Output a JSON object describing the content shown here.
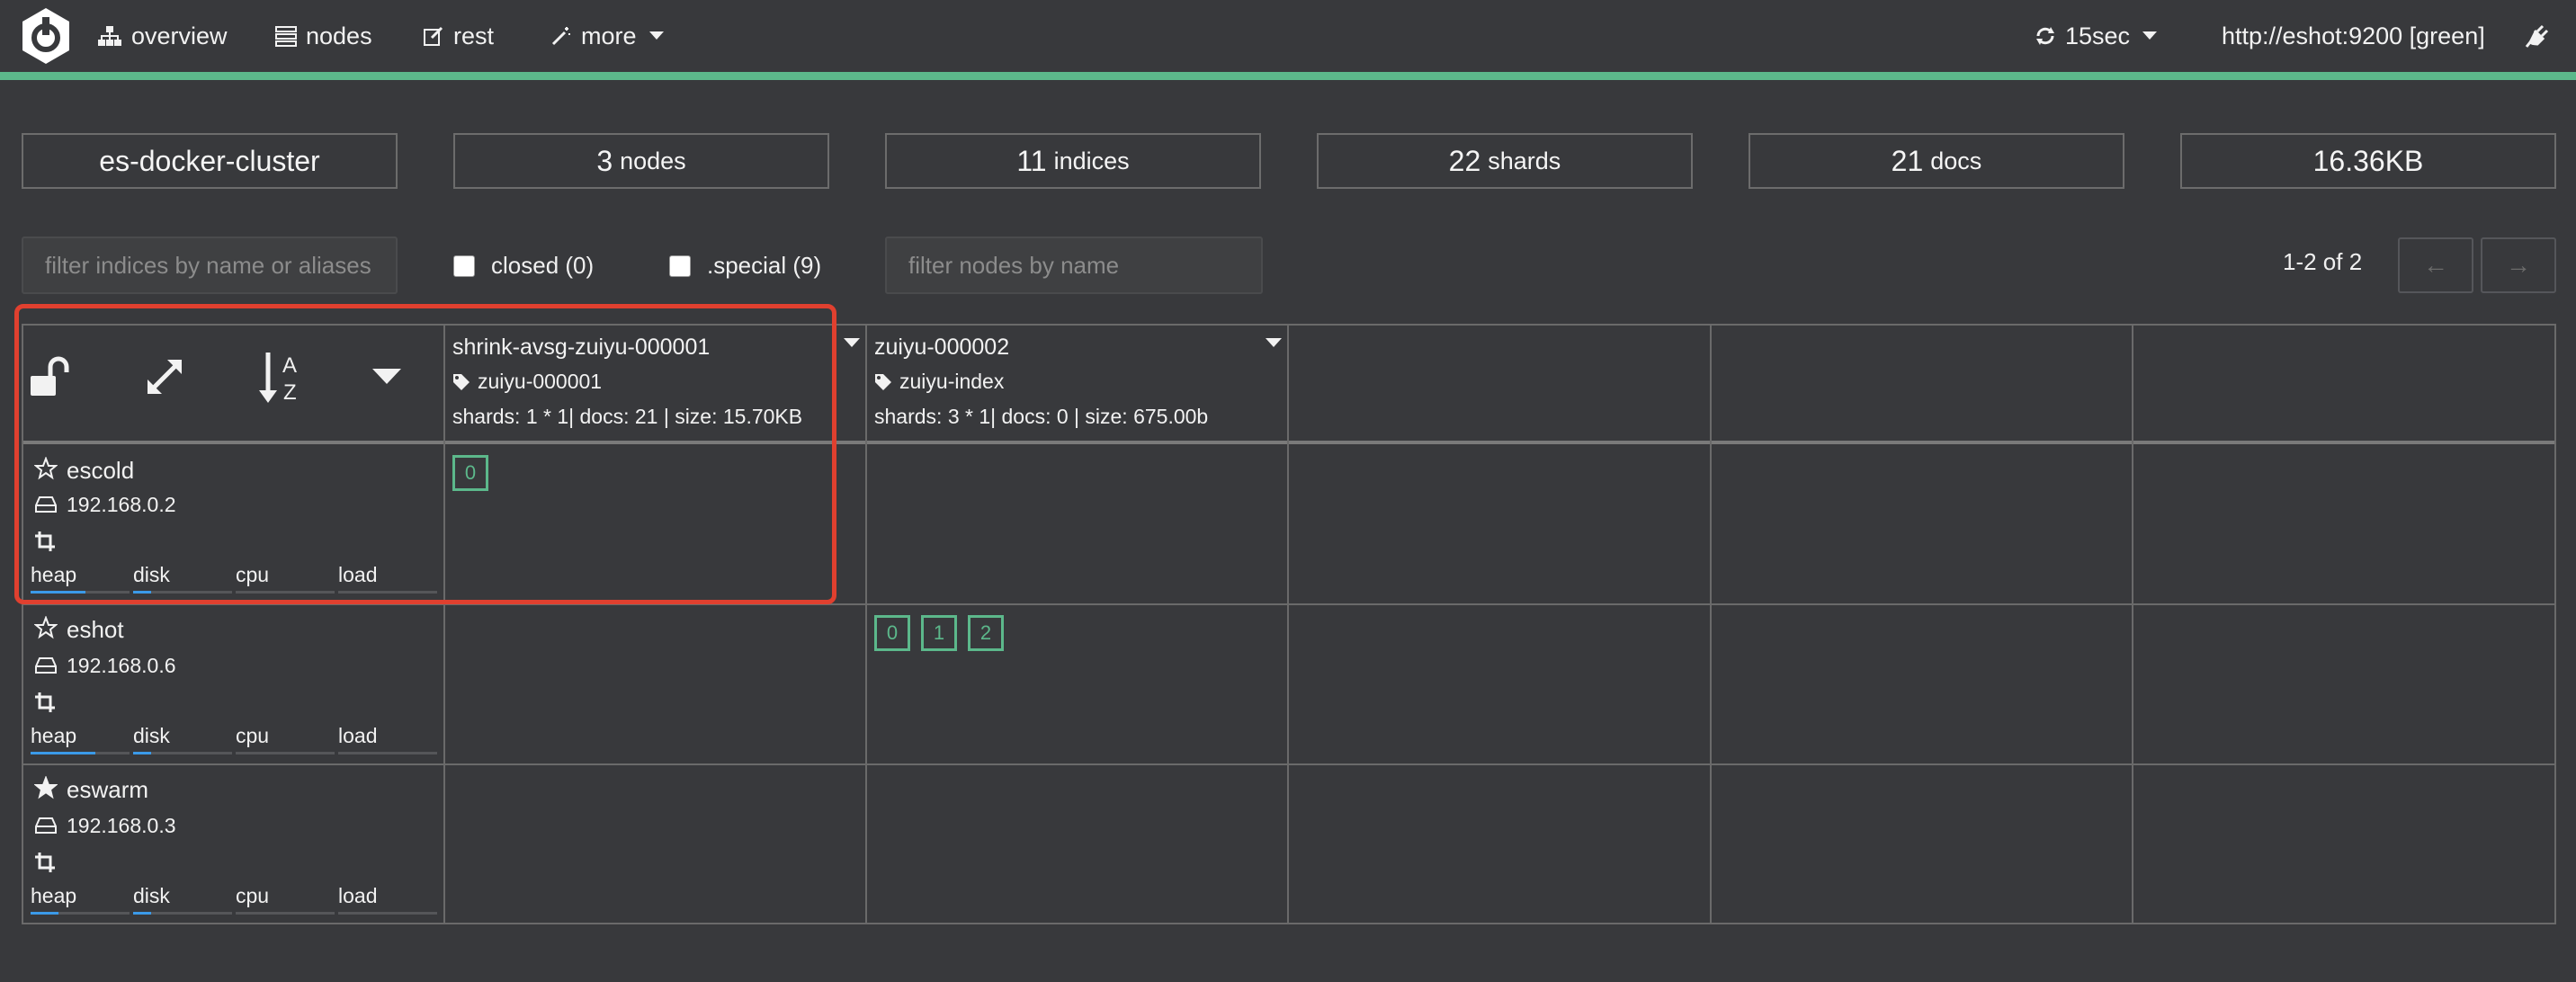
{
  "nav": {
    "overview": "overview",
    "nodes": "nodes",
    "rest": "rest",
    "more": "more",
    "refresh": "15sec",
    "connection": "http://eshot:9200 [green]"
  },
  "colors": {
    "status": "#5cb88b",
    "bar": "#3b9ae8",
    "highlight": "#e0402f"
  },
  "stats": {
    "cluster": "es-docker-cluster",
    "nodes_count": "3",
    "nodes_label": "nodes",
    "indices_count": "11",
    "indices_label": "indices",
    "shards_count": "22",
    "shards_label": "shards",
    "docs_count": "21",
    "docs_label": "docs",
    "size": "16.36KB"
  },
  "filters": {
    "indices_placeholder": "filter indices by name or aliases",
    "closed_label": "closed (0)",
    "special_label": ".special (9)",
    "nodes_placeholder": "filter nodes by name",
    "page_info": "1-2 of 2",
    "prev": "←",
    "next": "→"
  },
  "indices": [
    {
      "name": "shrink-avsg-zuiyu-000001",
      "alias": "zuiyu-000001",
      "info": "shards: 1 * 1| docs: 21 | size: 15.70KB"
    },
    {
      "name": "zuiyu-000002",
      "alias": "zuiyu-index",
      "info": "shards: 3 * 1| docs: 0 | size: 675.00b"
    }
  ],
  "nodes": [
    {
      "name": "escold",
      "ip": "192.168.0.2",
      "master": false,
      "shards_col0": [
        "0"
      ],
      "shards_col1": [],
      "heap": 0.55,
      "disk": 0.18
    },
    {
      "name": "eshot",
      "ip": "192.168.0.6",
      "master": false,
      "shards_col0": [],
      "shards_col1": [
        "0",
        "1",
        "2"
      ],
      "heap": 0.65,
      "disk": 0.18
    },
    {
      "name": "eswarm",
      "ip": "192.168.0.3",
      "master": true,
      "shards_col0": [],
      "shards_col1": [],
      "heap": 0.28,
      "disk": 0.18
    }
  ],
  "metric_labels": {
    "heap": "heap",
    "disk": "disk",
    "cpu": "cpu",
    "load": "load"
  }
}
